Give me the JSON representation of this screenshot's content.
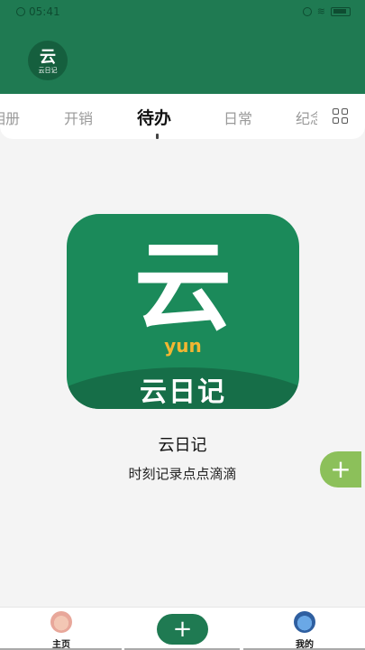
{
  "status": {
    "time": "05:41"
  },
  "brand": {
    "logo_big": "云",
    "logo_small": "云日记"
  },
  "tabs": [
    {
      "label": "相册"
    },
    {
      "label": "开销"
    },
    {
      "label": "待办"
    },
    {
      "label": "日常"
    },
    {
      "label": "纪念"
    }
  ],
  "app": {
    "logo_glyph": "云",
    "logo_pinyin": "yun",
    "logo_name": "云日记",
    "title": "云日记",
    "slogan": "时刻记录点点滴滴"
  },
  "fab": {
    "symbol": "+"
  },
  "bottom_nav": {
    "home_label": "主页",
    "add_symbol": "+",
    "mine_label": "我的"
  },
  "colors": {
    "primary": "#1f7a52",
    "fab": "#8cc05a",
    "accent": "#f2b632"
  },
  "icons": [
    "alarm-icon",
    "wifi-icon",
    "battery-icon",
    "grid-icon",
    "home-icon",
    "profile-icon",
    "add-icon"
  ]
}
